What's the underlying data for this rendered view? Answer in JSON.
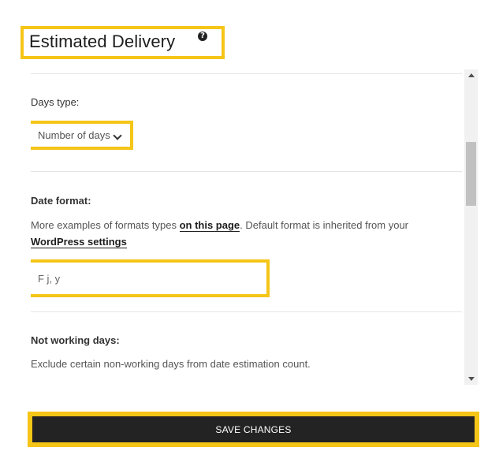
{
  "header": {
    "title": "Estimated Delivery",
    "help_icon": "question-circle-icon"
  },
  "settings": {
    "days_type": {
      "label": "Days type:",
      "selected": "Number of days"
    },
    "date_format": {
      "label": "Date format:",
      "description_before": "More examples of formats types ",
      "link_page": "on this page",
      "description_middle": ". Default format is inherited from your ",
      "link_wp": "WordPress settings",
      "value": "F j, y"
    },
    "not_working_days": {
      "label": "Not working days:",
      "description": "Exclude certain non-working days from date estimation count."
    }
  },
  "actions": {
    "save_label": "SAVE CHANGES"
  },
  "colors": {
    "highlight": "#f5c518",
    "button_bg": "#232323",
    "button_text": "#ffffff"
  }
}
